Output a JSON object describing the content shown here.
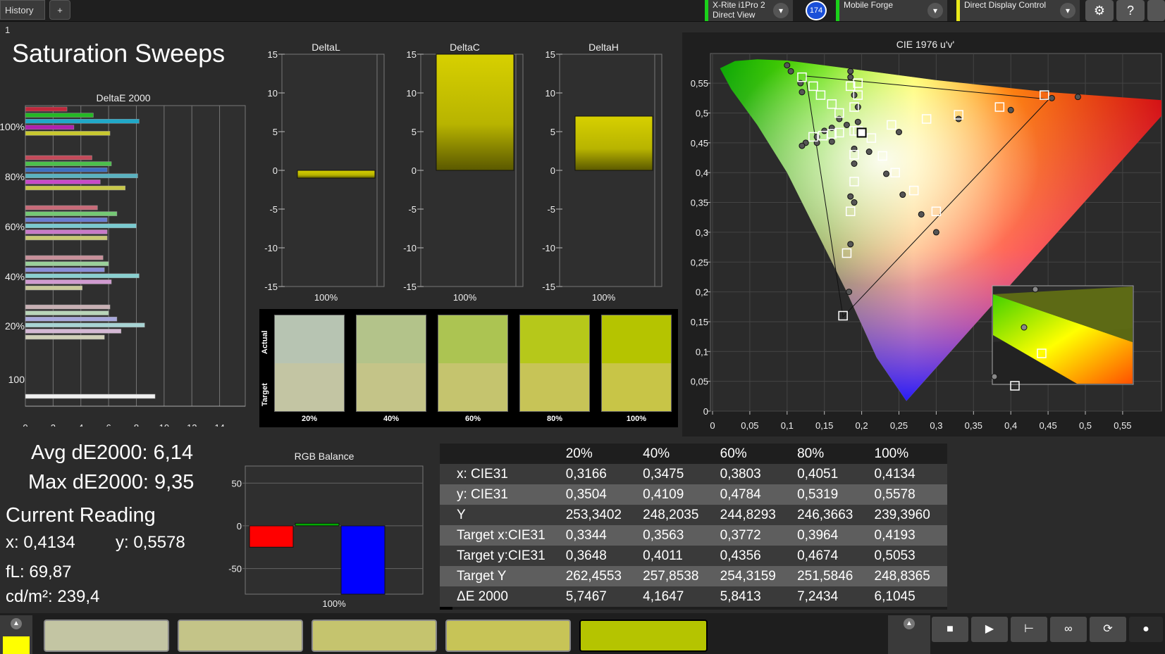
{
  "topbar": {
    "history_tab": "History 1",
    "add_tab": "+",
    "meter_line1": "X-Rite i1Pro 2",
    "meter_line2": "Direct View",
    "badge": "174",
    "profile": "Mobile Forge",
    "control": "Direct Display Control",
    "accent_meter": "#1ad11a",
    "accent_control": "#e8e81a"
  },
  "page_title": "Saturation Sweeps",
  "deltae_chart": {
    "title": "DeltaE 2000",
    "row_labels": [
      "100%",
      "80%",
      "60%",
      "40%",
      "20%",
      "100"
    ],
    "x_ticks": [
      "0",
      "2",
      "4",
      "6",
      "8",
      "10",
      "12",
      "14"
    ]
  },
  "delta_charts": [
    {
      "title": "DeltaL",
      "value": -1,
      "xlabel": "100%"
    },
    {
      "title": "DeltaC",
      "value": 15,
      "xlabel": "100%"
    },
    {
      "title": "DeltaH",
      "value": 7,
      "xlabel": "100%"
    }
  ],
  "delta_y_ticks": [
    "15",
    "10",
    "5",
    "0",
    "-5",
    "-10",
    "-15"
  ],
  "swatches": {
    "actual_label": "Actual",
    "target_label": "Target",
    "items": [
      {
        "label": "20%",
        "actual": "#b7c4b2",
        "target": "#c3c5a3"
      },
      {
        "label": "40%",
        "actual": "#b3c38a",
        "target": "#c4c488"
      },
      {
        "label": "60%",
        "actual": "#acc452",
        "target": "#c5c46e"
      },
      {
        "label": "80%",
        "actual": "#b6c81a",
        "target": "#c7c457"
      },
      {
        "label": "100%",
        "actual": "#b5c400",
        "target": "#c8c547"
      }
    ]
  },
  "summary": {
    "avg": "Avg dE2000: 6,14",
    "max": "Max dE2000: 9,35",
    "current_reading": "Current Reading",
    "x": "x: 0,4134",
    "y": "y: 0,5578",
    "fl": "fL: 69,87",
    "cdm": "cd/m²: 239,4"
  },
  "rgb_balance": {
    "title": "RGB Balance",
    "y_ticks": [
      "50",
      "0",
      "-50"
    ],
    "xlabel": "100%"
  },
  "table": {
    "headers": [
      "",
      "20%",
      "40%",
      "60%",
      "80%",
      "100%"
    ],
    "rows": [
      {
        "label": "x: CIE31",
        "values": [
          "0,3166",
          "0,3475",
          "0,3803",
          "0,4051",
          "0,4134"
        ]
      },
      {
        "label": "y: CIE31",
        "values": [
          "0,3504",
          "0,4109",
          "0,4784",
          "0,5319",
          "0,5578"
        ]
      },
      {
        "label": "Y",
        "values": [
          "253,3402",
          "248,2035",
          "244,8293",
          "246,3663",
          "239,3960"
        ]
      },
      {
        "label": "Target x:CIE31",
        "values": [
          "0,3344",
          "0,3563",
          "0,3772",
          "0,3964",
          "0,4193"
        ]
      },
      {
        "label": "Target y:CIE31",
        "values": [
          "0,3648",
          "0,4011",
          "0,4356",
          "0,4674",
          "0,5053"
        ]
      },
      {
        "label": "Target Y",
        "values": [
          "262,4553",
          "257,8538",
          "254,3159",
          "251,5846",
          "248,8365"
        ]
      },
      {
        "label": "ΔE 2000",
        "values": [
          "5,7467",
          "4,1647",
          "5,8413",
          "7,2434",
          "6,1045"
        ]
      }
    ]
  },
  "cie": {
    "title": "CIE 1976 u'v'",
    "x_ticks": [
      "0",
      "0,05",
      "0,1",
      "0,15",
      "0,2",
      "0,25",
      "0,3",
      "0,35",
      "0,4",
      "0,45",
      "0,5",
      "0,55"
    ],
    "y_ticks": [
      "0,55",
      "0,5",
      "0,45",
      "0,4",
      "0,35",
      "0,3",
      "0,25",
      "0,2",
      "0,15",
      "0,1",
      "0,05",
      "0"
    ]
  },
  "chart_data": [
    {
      "type": "bar",
      "title": "DeltaE 2000",
      "orientation": "horizontal",
      "xlim": [
        0,
        15
      ],
      "groups": [
        {
          "label": "100%",
          "values": [
            3.0,
            4.9,
            8.2,
            3.5,
            6.1
          ],
          "colors": [
            "#c0283c",
            "#25b825",
            "#20a8c8",
            "#b020b0",
            "#c8c830"
          ]
        },
        {
          "label": "80%",
          "values": [
            4.8,
            6.2,
            5.9,
            8.1,
            5.4,
            7.2
          ],
          "colors": [
            "#c44a5a",
            "#4cc04c",
            "#3f6fc0",
            "#5ab2c0",
            "#c84ac8",
            "#c8c84a"
          ]
        },
        {
          "label": "60%",
          "values": [
            5.2,
            6.6,
            5.9,
            8.0,
            5.9,
            5.9
          ],
          "colors": [
            "#c86a78",
            "#74c874",
            "#6a7cd0",
            "#7acad0",
            "#c87ac8",
            "#c8c874"
          ]
        },
        {
          "label": "40%",
          "values": [
            5.6,
            6.0,
            5.7,
            8.2,
            6.2,
            4.1
          ],
          "colors": [
            "#c8909a",
            "#9ad09a",
            "#8a8ed8",
            "#8ad0d0",
            "#d09ad0",
            "#c8c89a"
          ]
        },
        {
          "label": "20%",
          "values": [
            6.1,
            6.0,
            6.6,
            8.6,
            6.9,
            5.7
          ],
          "colors": [
            "#c8b0b4",
            "#b8d4b8",
            "#a8a8dc",
            "#a8d4d4",
            "#d4b8d4",
            "#d0d0b8"
          ]
        },
        {
          "label": "100",
          "values": [
            9.35
          ],
          "colors": [
            "#f0f0f0"
          ]
        }
      ]
    },
    {
      "type": "bar",
      "title": "RGB Balance",
      "categories": [
        "R",
        "G",
        "B"
      ],
      "values": [
        -25,
        3,
        -80
      ],
      "colors": [
        "#ff0000",
        "#00aa00",
        "#0000ff"
      ],
      "ylim": [
        -80,
        70
      ]
    },
    {
      "type": "scatter",
      "title": "CIE 1976 u'v'",
      "xlim": [
        0,
        0.6
      ],
      "ylim": [
        0,
        0.6
      ],
      "target_points": [
        [
          0.12,
          0.56
        ],
        [
          0.135,
          0.545
        ],
        [
          0.145,
          0.53
        ],
        [
          0.16,
          0.515
        ],
        [
          0.17,
          0.5
        ],
        [
          0.185,
          0.545
        ],
        [
          0.195,
          0.55
        ],
        [
          0.195,
          0.53
        ],
        [
          0.19,
          0.51
        ],
        [
          0.195,
          0.47
        ],
        [
          0.135,
          0.46
        ],
        [
          0.148,
          0.462
        ],
        [
          0.16,
          0.465
        ],
        [
          0.17,
          0.467
        ],
        [
          0.19,
          0.47
        ],
        [
          0.213,
          0.458
        ],
        [
          0.24,
          0.48
        ],
        [
          0.287,
          0.49
        ],
        [
          0.33,
          0.497
        ],
        [
          0.385,
          0.51
        ],
        [
          0.445,
          0.53
        ],
        [
          0.19,
          0.43
        ],
        [
          0.228,
          0.428
        ],
        [
          0.19,
          0.385
        ],
        [
          0.245,
          0.4
        ],
        [
          0.27,
          0.37
        ],
        [
          0.3,
          0.335
        ],
        [
          0.185,
          0.335
        ],
        [
          0.18,
          0.265
        ],
        [
          0.175,
          0.16
        ]
      ],
      "measured_points": [
        [
          0.1,
          0.58
        ],
        [
          0.105,
          0.57
        ],
        [
          0.118,
          0.55
        ],
        [
          0.12,
          0.535
        ],
        [
          0.185,
          0.57
        ],
        [
          0.185,
          0.56
        ],
        [
          0.19,
          0.53
        ],
        [
          0.195,
          0.51
        ],
        [
          0.195,
          0.485
        ],
        [
          0.18,
          0.48
        ],
        [
          0.17,
          0.49
        ],
        [
          0.16,
          0.475
        ],
        [
          0.15,
          0.47
        ],
        [
          0.14,
          0.46
        ],
        [
          0.125,
          0.45
        ],
        [
          0.12,
          0.445
        ],
        [
          0.14,
          0.45
        ],
        [
          0.16,
          0.452
        ],
        [
          0.19,
          0.44
        ],
        [
          0.21,
          0.435
        ],
        [
          0.25,
          0.468
        ],
        [
          0.19,
          0.415
        ],
        [
          0.233,
          0.398
        ],
        [
          0.255,
          0.363
        ],
        [
          0.28,
          0.33
        ],
        [
          0.185,
          0.36
        ],
        [
          0.19,
          0.35
        ],
        [
          0.185,
          0.28
        ],
        [
          0.183,
          0.2
        ],
        [
          0.3,
          0.3
        ],
        [
          0.33,
          0.49
        ],
        [
          0.4,
          0.505
        ],
        [
          0.455,
          0.525
        ],
        [
          0.49,
          0.527
        ]
      ]
    }
  ]
}
